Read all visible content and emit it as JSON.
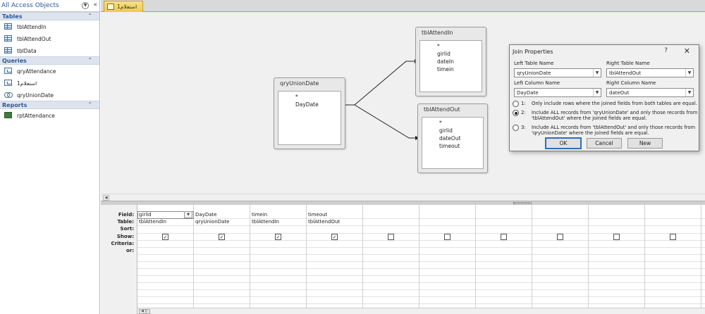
{
  "nav": {
    "title": "All Access Objects",
    "groups": [
      {
        "name": "Tables",
        "items": [
          "tblAttendIn",
          "tblAttendOut",
          "tblData"
        ]
      },
      {
        "name": "Queries",
        "items": [
          "qryAttendance",
          "استعلام1",
          "qryUnionDate"
        ]
      },
      {
        "name": "Reports",
        "items": [
          "rptAttendance"
        ]
      }
    ]
  },
  "tab": {
    "label": "استعلام1"
  },
  "design": {
    "union": {
      "title": "qryUnionDate",
      "fields": [
        "*",
        "DayDate"
      ]
    },
    "attendIn": {
      "title": "tblAttendIn",
      "fields": [
        "*",
        "girlid",
        "dateIn",
        "timein"
      ]
    },
    "attendOut": {
      "title": "tblAttendOut",
      "fields": [
        "*",
        "girlid",
        "dateOut",
        "timeout"
      ]
    }
  },
  "grid": {
    "row_labels": [
      "Field:",
      "Table:",
      "Sort:",
      "Show:",
      "Criteria:",
      "or:"
    ],
    "columns": [
      {
        "field": "girlid",
        "table": "tblAttendIn",
        "show": true
      },
      {
        "field": "DayDate",
        "table": "qryUnionDate",
        "show": true
      },
      {
        "field": "timein",
        "table": "tblAttendIn",
        "show": true
      },
      {
        "field": "timeout",
        "table": "tblAttendOut",
        "show": true
      },
      {
        "field": "",
        "table": "",
        "show": false
      },
      {
        "field": "",
        "table": "",
        "show": false
      },
      {
        "field": "",
        "table": "",
        "show": false
      },
      {
        "field": "",
        "table": "",
        "show": false
      },
      {
        "field": "",
        "table": "",
        "show": false
      },
      {
        "field": "",
        "table": "",
        "show": false
      }
    ]
  },
  "dialog": {
    "title": "Join Properties",
    "help": "?",
    "close": "✕",
    "left_table_label": "Left Table Name",
    "left_table_value": "qryUnionDate",
    "right_table_label": "Right Table Name",
    "right_table_value": "tblAttendOut",
    "left_column_label": "Left Column Name",
    "left_column_value": "DayDate",
    "right_column_label": "Right Column Name",
    "right_column_value": "dateOut",
    "options": [
      {
        "num": "1:",
        "text": "Only include rows where the joined fields from both tables are equal.",
        "selected": false
      },
      {
        "num": "2:",
        "text": "Include ALL records from 'qryUnionDate' and only those records from 'tblAttendOut' where the joined fields are equal.",
        "selected": true
      },
      {
        "num": "3:",
        "text": "Include ALL records from 'tblAttendOut' and only those records from 'qryUnionDate' where the joined fields are equal.",
        "selected": false
      }
    ],
    "ok": "OK",
    "cancel": "Cancel",
    "new": "New"
  }
}
